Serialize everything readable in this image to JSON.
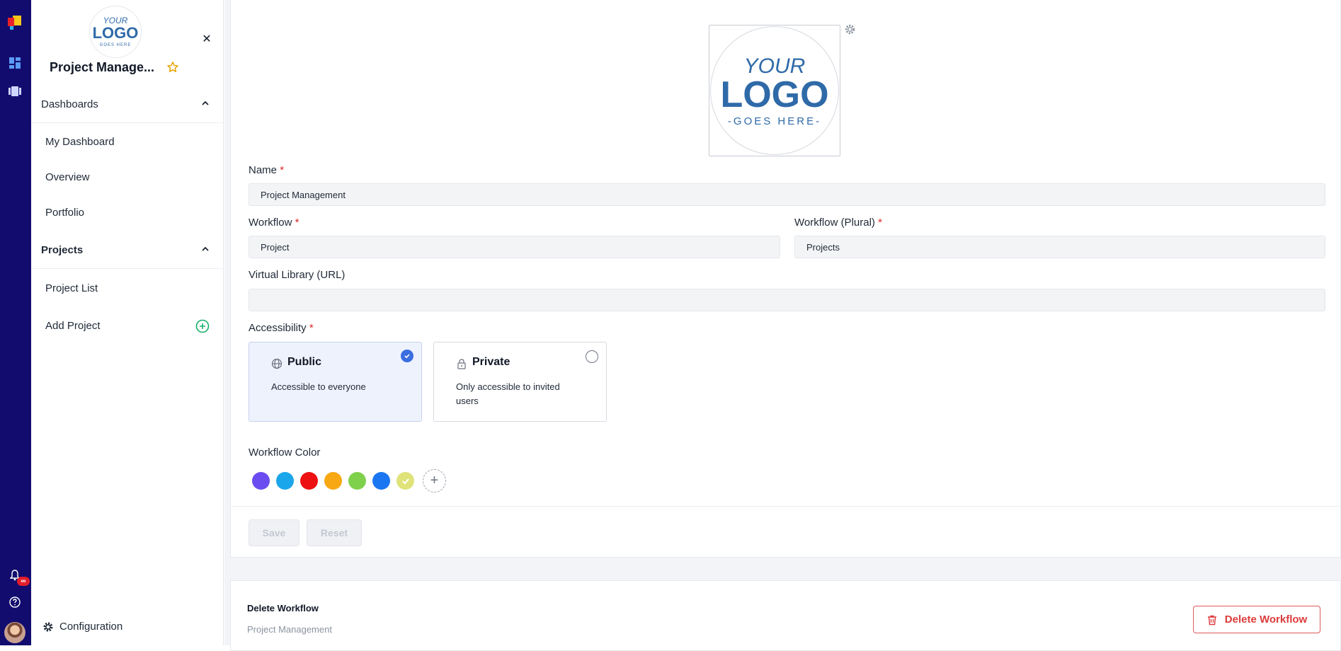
{
  "rail": {
    "notification_badge": "∞"
  },
  "sidebar": {
    "logo_text": {
      "line1": "YOUR",
      "line2": "LOGO",
      "line3": "GOES HERE"
    },
    "title": "Project Manage...",
    "sections": [
      {
        "label": "Dashboards",
        "items": [
          "My Dashboard",
          "Overview",
          "Portfolio"
        ]
      },
      {
        "label": "Projects",
        "items": [
          "Project List",
          "Add Project"
        ]
      }
    ],
    "configuration": "Configuration"
  },
  "form": {
    "logo_text": {
      "line1": "YOUR",
      "line2": "LOGO",
      "line3": "-GOES HERE-"
    },
    "name_label": "Name",
    "name_value": "Project Management",
    "workflow_label": "Workflow",
    "workflow_value": "Project",
    "workflow_plural_label": "Workflow (Plural)",
    "workflow_plural_value": "Projects",
    "library_label": "Virtual Library (URL)",
    "library_value": "",
    "required_mark": "*",
    "accessibility_label": "Accessibility",
    "public_title": "Public",
    "public_desc": "Accessible to everyone",
    "private_title": "Private",
    "private_desc": "Only accessible to invited users",
    "color_label": "Workflow Color",
    "colors": [
      "#6b4cf0",
      "#1aa6ea",
      "#ee1111",
      "#f7a812",
      "#7fd14b",
      "#1b76f2",
      "#dfe37a"
    ],
    "selected_color": "#dfe37a",
    "add_color": "+",
    "save_label": "Save",
    "reset_label": "Reset"
  },
  "delete_section": {
    "title": "Delete Workflow",
    "subtitle": "Project Management",
    "button_label": "Delete Workflow"
  },
  "colors": {
    "rail_bg": "#120c6e",
    "accent": "#3b6fe0",
    "danger": "#dc3b3b",
    "add_green": "#16b26b"
  }
}
